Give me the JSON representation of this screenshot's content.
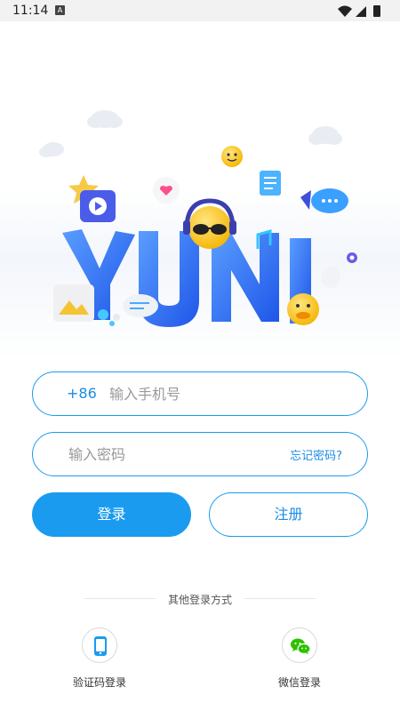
{
  "status_bar": {
    "time": "11:14",
    "notif_glyph": "A"
  },
  "hero": {
    "brand_text": "YUNI"
  },
  "login_form": {
    "country_code": "+86",
    "phone_placeholder": "输入手机号",
    "password_placeholder": "输入密码",
    "forgot_password": "忘记密码?",
    "login_button": "登录",
    "register_button": "注册"
  },
  "other_login": {
    "title": "其他登录方式",
    "options": [
      {
        "label": "验证码登录",
        "icon": "phone-icon"
      },
      {
        "label": "微信登录",
        "icon": "wechat-icon"
      }
    ]
  },
  "colors": {
    "accent": "#1a9bf0",
    "brand_blue": "#2f6ff0",
    "wechat_green": "#2dc100"
  }
}
